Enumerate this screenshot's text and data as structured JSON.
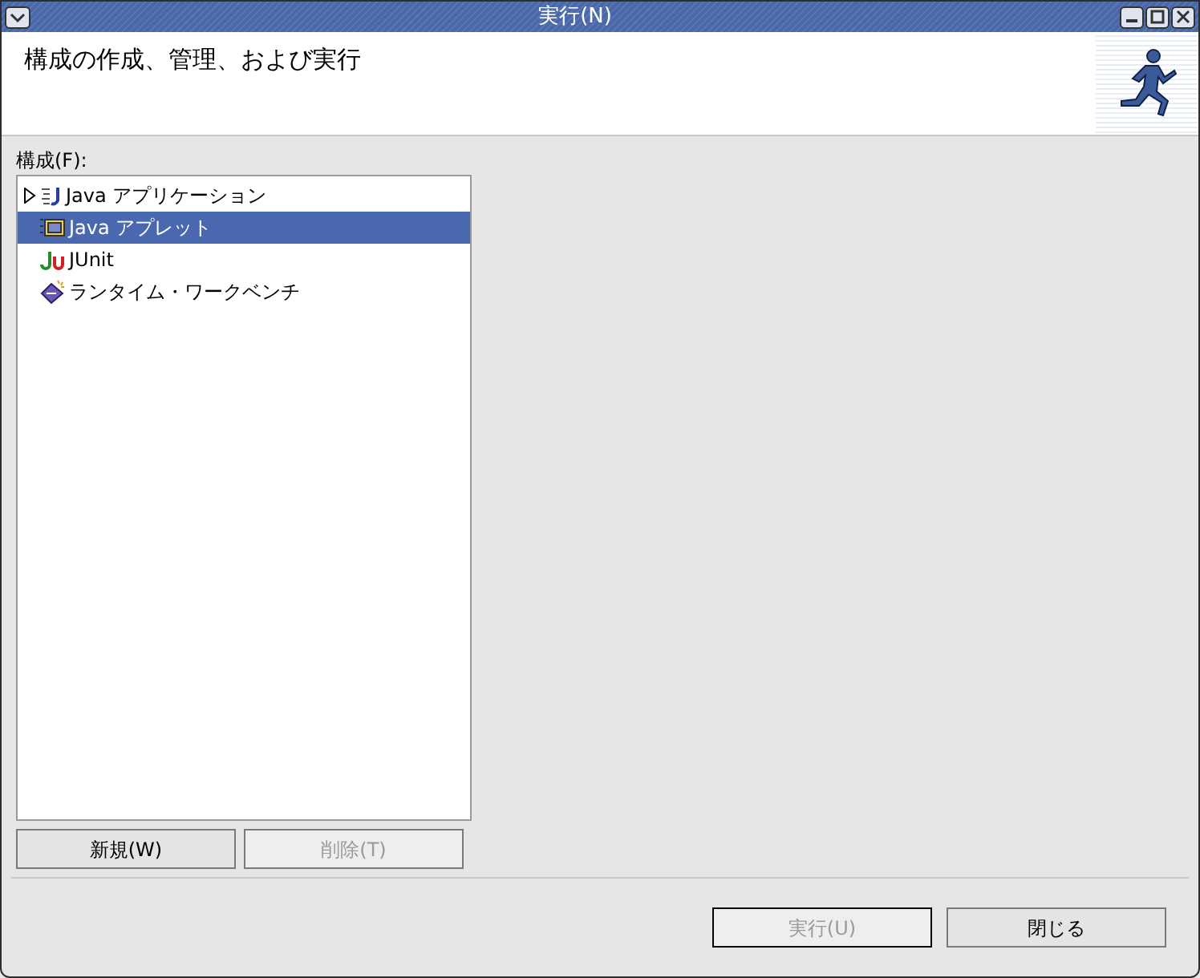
{
  "window": {
    "title": "実行(N)"
  },
  "header": {
    "title": "構成の作成、管理、および実行"
  },
  "configurations": {
    "label": "構成(F):",
    "items": [
      {
        "kind": "java-app",
        "label": "Java アプリケーション",
        "expanded": false,
        "selected": false
      },
      {
        "kind": "applet",
        "label": "Java アプレット",
        "selected": true
      },
      {
        "kind": "junit",
        "label": "JUnit",
        "selected": false
      },
      {
        "kind": "workbench",
        "label": "ランタイム・ワークベンチ",
        "selected": false
      }
    ]
  },
  "list_buttons": [
    {
      "label": "新規(W)",
      "disabled": false
    },
    {
      "label": "削除(T)",
      "disabled": true
    }
  ],
  "dialog_buttons": [
    {
      "label": "実行(U)",
      "disabled": true,
      "default": true
    },
    {
      "label": "閉じる",
      "disabled": false,
      "default": false
    }
  ]
}
